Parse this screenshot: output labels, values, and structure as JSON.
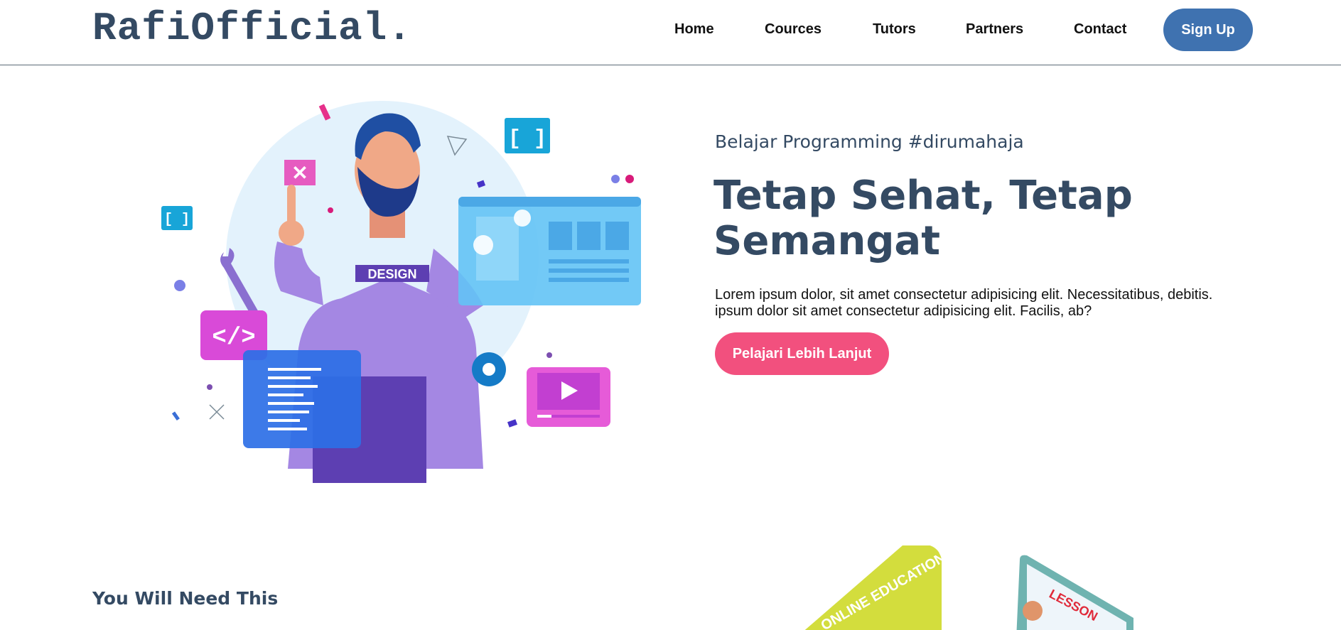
{
  "header": {
    "logo": "RafiOfficial.",
    "nav": [
      "Home",
      "Cources",
      "Tutors",
      "Partners",
      "Contact"
    ],
    "signup_label": "Sign Up"
  },
  "hero": {
    "eyebrow": "Belajar Programming #dirumahaja",
    "title": "Tetap Sehat, Tetap Semangat",
    "text": "Lorem ipsum dolor, sit amet consectetur adipisicing elit. Necessitatibus, debitis. ipsum dolor sit amet consectetur adipisicing elit. Facilis, ab?",
    "cta_label": "Pelajari Lebih Lanjut",
    "illustration": {
      "shirt_text": "DESIGN"
    }
  },
  "section": {
    "title": "You Will Need This",
    "card1_text": "ONLINE EDUCATION",
    "card2_text": "LESSON"
  },
  "colors": {
    "brand": "#344a63",
    "signup": "#3f72b0",
    "cta": "#f2507e"
  }
}
